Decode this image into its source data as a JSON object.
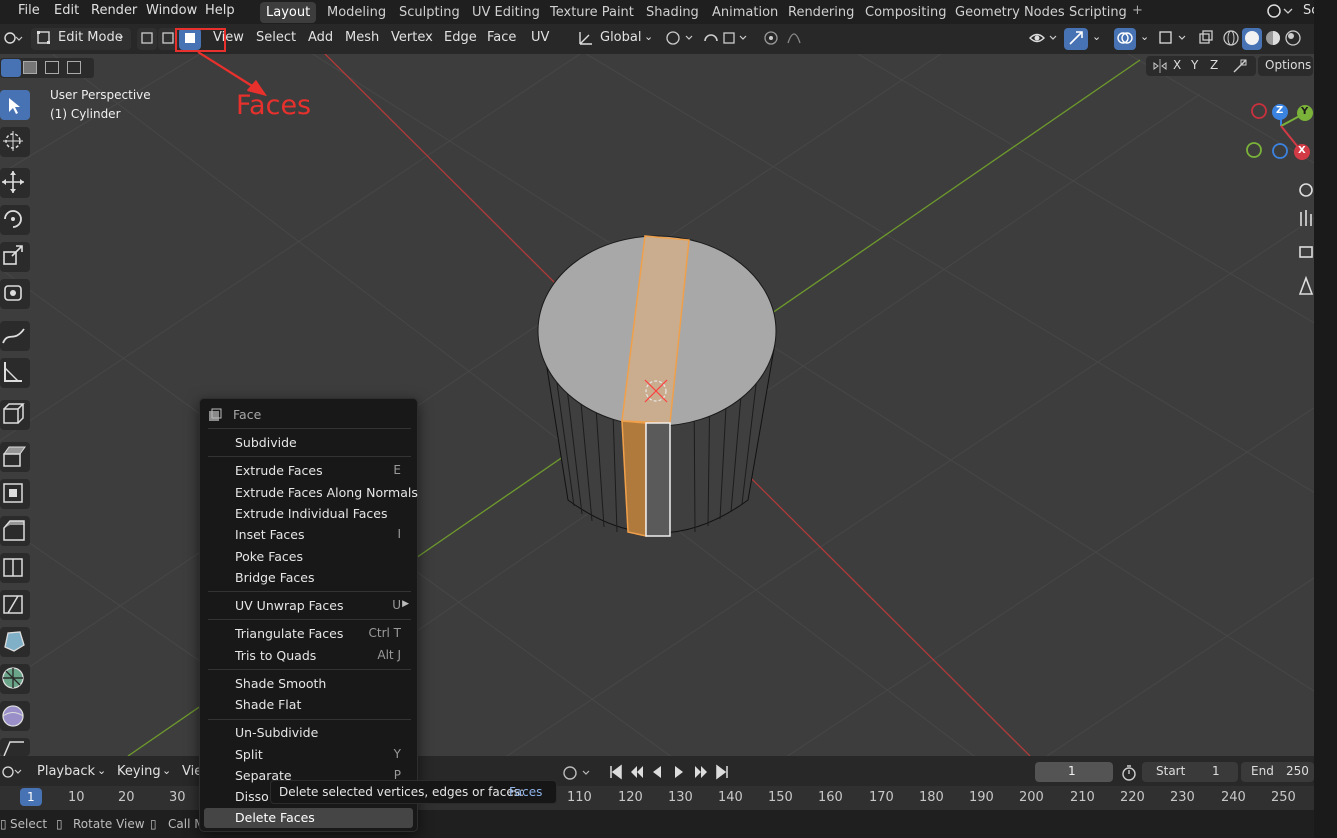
{
  "topbar": {
    "menus": [
      "File",
      "Edit",
      "Render",
      "Window",
      "Help"
    ],
    "workspaces": [
      "Layout",
      "Modeling",
      "Sculpting",
      "UV Editing",
      "Texture Paint",
      "Shading",
      "Animation",
      "Rendering",
      "Compositing",
      "Geometry Nodes",
      "Scripting"
    ],
    "active_workspace": "Layout",
    "scene_label": "Sc"
  },
  "header": {
    "mode": "Edit Mode",
    "menus": [
      "View",
      "Select",
      "Add",
      "Mesh",
      "Vertex",
      "Edge",
      "Face",
      "UV"
    ],
    "orientation": "Global",
    "axis_labels": [
      "X",
      "Y",
      "Z"
    ],
    "options": "Options"
  },
  "annotation": {
    "label": "Faces",
    "color": "#e8312d"
  },
  "viewport": {
    "perspective": "User Perspective",
    "object": "(1) Cylinder",
    "gizmo": {
      "x": "X",
      "y": "Y",
      "z": "Z"
    }
  },
  "context_menu": {
    "title": "Face",
    "items": [
      {
        "label": "Subdivide",
        "shortcut": ""
      },
      {
        "label": "Extrude Faces",
        "shortcut": "E"
      },
      {
        "label": "Extrude Faces Along Normals",
        "shortcut": ""
      },
      {
        "label": "Extrude Individual Faces",
        "shortcut": ""
      },
      {
        "label": "Inset Faces",
        "shortcut": "I"
      },
      {
        "label": "Poke Faces",
        "shortcut": ""
      },
      {
        "label": "Bridge Faces",
        "shortcut": ""
      },
      {
        "label": "UV Unwrap Faces",
        "shortcut": "U"
      },
      {
        "label": "Triangulate Faces",
        "shortcut": "Ctrl T"
      },
      {
        "label": "Tris to Quads",
        "shortcut": "Alt J"
      },
      {
        "label": "Shade Smooth",
        "shortcut": ""
      },
      {
        "label": "Shade Flat",
        "shortcut": ""
      },
      {
        "label": "Un-Subdivide",
        "shortcut": ""
      },
      {
        "label": "Split",
        "shortcut": "Y"
      },
      {
        "label": "Separate",
        "shortcut": "P"
      },
      {
        "label": "Disso",
        "shortcut": ""
      },
      {
        "label": "Delete Faces",
        "shortcut": ""
      }
    ],
    "highlighted": "Delete Faces"
  },
  "tooltip": {
    "text": "Delete selected vertices, edges or faces:",
    "value": "Faces"
  },
  "timeline": {
    "menus": [
      "Playback",
      "Keying",
      "Vie"
    ],
    "current_frame": "1",
    "start_label": "Start",
    "start_value": "1",
    "end_label": "End",
    "end_value": "250",
    "ruler_left": [
      "1",
      "10",
      "20",
      "30"
    ],
    "ruler_right": [
      "110",
      "120",
      "130",
      "140",
      "150",
      "160",
      "170",
      "180",
      "190",
      "200",
      "210",
      "220",
      "230",
      "240",
      "250"
    ]
  },
  "statusbar": {
    "items": [
      "Select",
      "Rotate View",
      "Call Menu"
    ]
  },
  "colors": {
    "selection_orange": "#f0a04b",
    "accent_blue": "#4772b3",
    "axis_red": "#c0392b",
    "axis_green": "#7aa832"
  }
}
